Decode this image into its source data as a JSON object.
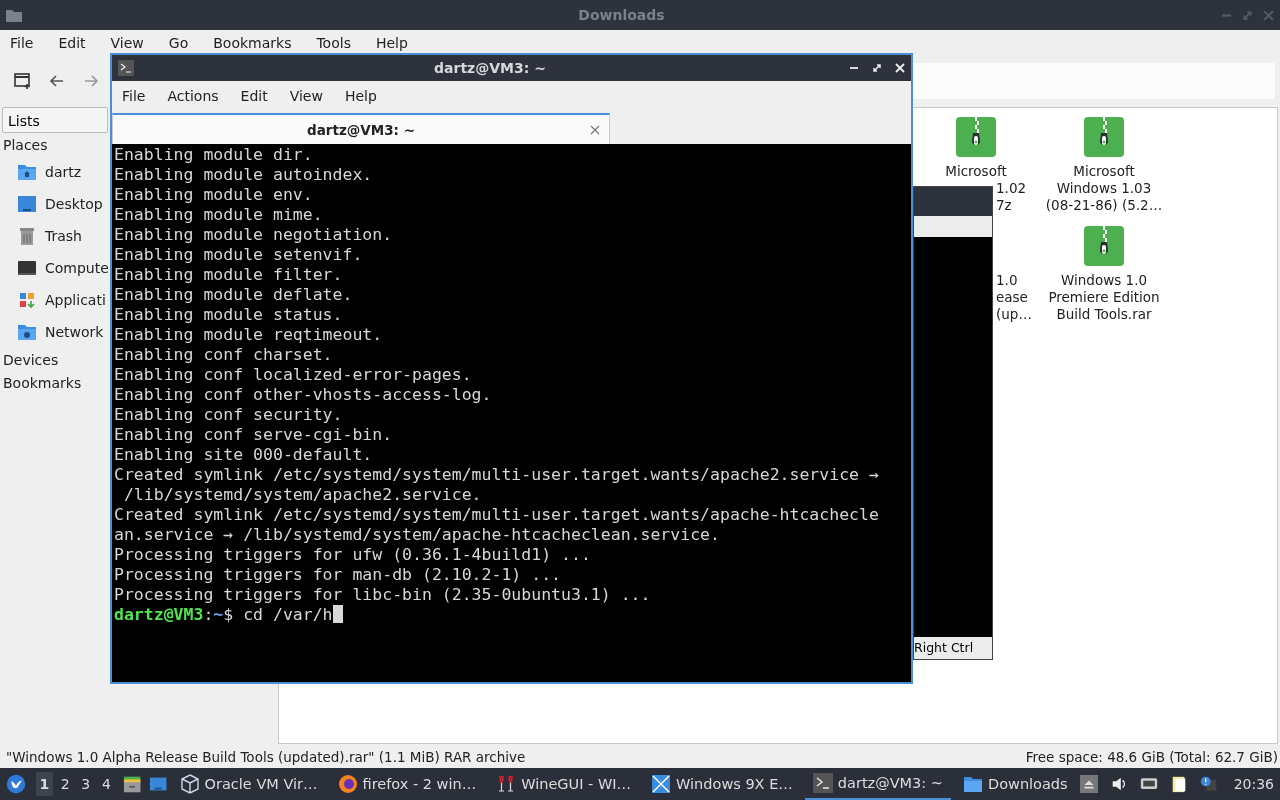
{
  "file_manager": {
    "title": "Downloads",
    "menu": [
      "File",
      "Edit",
      "View",
      "Go",
      "Bookmarks",
      "Tools",
      "Help"
    ],
    "sidebar": {
      "dropdown": "Lists",
      "sections": [
        {
          "label": "Places",
          "items": [
            {
              "label": "dartz",
              "kind": "home"
            },
            {
              "label": "Desktop",
              "kind": "desktop"
            },
            {
              "label": "Trash",
              "kind": "trash"
            },
            {
              "label": "Compute",
              "kind": "computer"
            },
            {
              "label": "Applicati",
              "kind": "apps"
            },
            {
              "label": "Network",
              "kind": "network"
            }
          ]
        },
        {
          "label": "Devices"
        },
        {
          "label": "Bookmarks"
        }
      ]
    },
    "files": [
      {
        "icon": true,
        "lines": [
          {
            "text": "Microsoft",
            "cut": false
          },
          {
            "text": "1.02",
            "cut": true
          },
          {
            "text": "7z",
            "cut": true
          }
        ]
      },
      {
        "icon": true,
        "lines": [
          {
            "text": "Microsoft",
            "cut": false
          },
          {
            "text": "Windows 1.03",
            "cut": false
          },
          {
            "text": "(08-21-86) (5.2…",
            "cut": false
          }
        ]
      },
      {
        "icon": false,
        "lines": [
          {
            "text": "1.0",
            "cut": true
          },
          {
            "text": "ease",
            "cut": true
          },
          {
            "text": "(up…",
            "cut": true
          }
        ]
      },
      {
        "icon": true,
        "lines": [
          {
            "text": "Windows 1.0",
            "cut": false
          },
          {
            "text": "Premiere Edition",
            "cut": false
          },
          {
            "text": "Build Tools.rar",
            "cut": false
          }
        ]
      }
    ],
    "status_left": "\"Windows 1.0 Alpha Release Build Tools (updated).rar\" (1.1 MiB) RAR archive",
    "status_right": "Free space: 48.6 GiB (Total: 62.7 GiB)"
  },
  "vm_window": {
    "status": "Right Ctrl"
  },
  "terminal": {
    "title": "dartz@VM3: ~",
    "menu": [
      "File",
      "Actions",
      "Edit",
      "View",
      "Help"
    ],
    "tab": {
      "label": "dartz@VM3: ~",
      "selected": true
    },
    "lines": [
      "Enabling module dir.",
      "Enabling module autoindex.",
      "Enabling module env.",
      "Enabling module mime.",
      "Enabling module negotiation.",
      "Enabling module setenvif.",
      "Enabling module filter.",
      "Enabling module deflate.",
      "Enabling module status.",
      "Enabling module reqtimeout.",
      "Enabling conf charset.",
      "Enabling conf localized-error-pages.",
      "Enabling conf other-vhosts-access-log.",
      "Enabling conf security.",
      "Enabling conf serve-cgi-bin.",
      "Enabling site 000-default.",
      "Created symlink /etc/systemd/system/multi-user.target.wants/apache2.service →",
      " /lib/systemd/system/apache2.service.",
      "Created symlink /etc/systemd/system/multi-user.target.wants/apache-htcachecle",
      "an.service → /lib/systemd/system/apache-htcacheclean.service.",
      "Processing triggers for ufw (0.36.1-4build1) ...",
      "Processing triggers for man-db (2.10.2-1) ...",
      "Processing triggers for libc-bin (2.35-0ubuntu3.1) ..."
    ],
    "prompt": {
      "user": "dartz@VM3",
      "separator": ":",
      "path": "~",
      "rest": "$ cd /var/h",
      "cursor": true
    }
  },
  "taskbar": {
    "workspaces": [
      {
        "label": "1",
        "selected": true
      },
      {
        "label": "2",
        "selected": false
      },
      {
        "label": "3",
        "selected": false
      },
      {
        "label": "4",
        "selected": false
      }
    ],
    "tasks": [
      {
        "label": "Oracle VM Vir…",
        "kind": "vbox",
        "selected": false
      },
      {
        "label": "firefox - 2 win…",
        "kind": "firefox",
        "selected": false
      },
      {
        "label": "WineGUI - WI…",
        "kind": "wine",
        "selected": false
      },
      {
        "label": "Windows 9X E…",
        "kind": "win9x",
        "selected": false
      },
      {
        "label": "dartz@VM3: ~",
        "kind": "terminal",
        "selected": true
      },
      {
        "label": "Downloads",
        "kind": "folder",
        "selected": false
      }
    ],
    "clock": "20:36"
  }
}
